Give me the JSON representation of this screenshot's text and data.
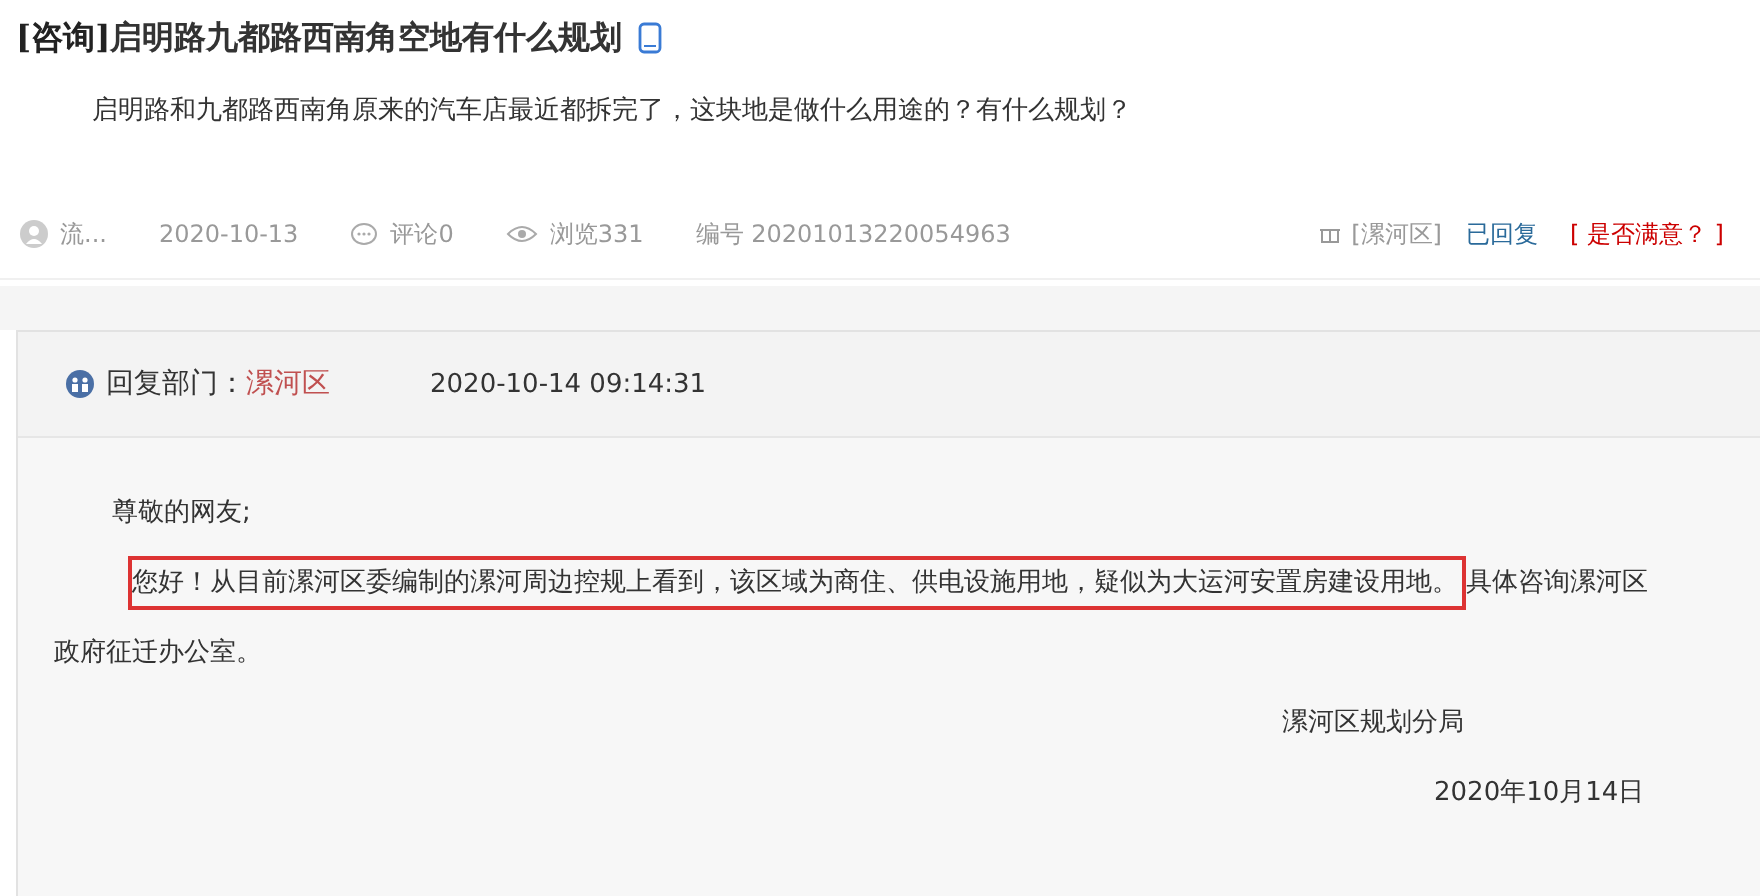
{
  "question": {
    "category": "[咨询]",
    "title": "启明路九都路西南角空地有什么规划",
    "text": "启明路和九都路西南角原来的汽车店最近都拆完了，这块地是做什么用途的？有什么规划？"
  },
  "meta": {
    "user": "流...",
    "date": "2020-10-13",
    "comments": "评论0",
    "views": "浏览331",
    "number": "编号 20201013220054963",
    "district": "[漯河区]",
    "status": "已回复",
    "satisfaction": "[ 是否满意？ ]"
  },
  "reply": {
    "department_label": "回复部门：",
    "department": "漯河区",
    "time": "2020-10-14 09:14:31",
    "greeting": "尊敬的网友;",
    "highlighted": "您好！从目前漯河区委编制的漯河周边控规上看到，该区域为商住、供电设施用地，疑似为大运河安置房建设用地。",
    "rest": "具体咨询漯河区政府征迁办公室。",
    "signature": "漯河区规划分局",
    "date": "2020年10月14日"
  }
}
